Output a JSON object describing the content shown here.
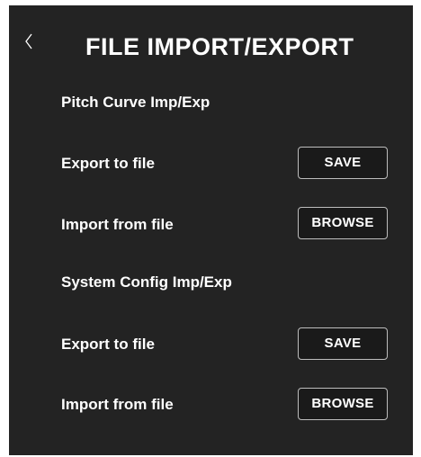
{
  "header": {
    "title": "FILE IMPORT/EXPORT",
    "back_icon": "chevron-left-icon"
  },
  "sections": [
    {
      "title": "Pitch Curve Imp/Exp",
      "rows": [
        {
          "label": "Export to file",
          "button": "SAVE"
        },
        {
          "label": "Import from file",
          "button": "BROWSE"
        }
      ]
    },
    {
      "title": "System Config Imp/Exp",
      "rows": [
        {
          "label": "Export to file",
          "button": "SAVE"
        },
        {
          "label": "Import from file",
          "button": "BROWSE"
        }
      ]
    }
  ],
  "colors": {
    "background": "#232323",
    "text": "#ffffff",
    "button_border": "#bdbdbd"
  }
}
